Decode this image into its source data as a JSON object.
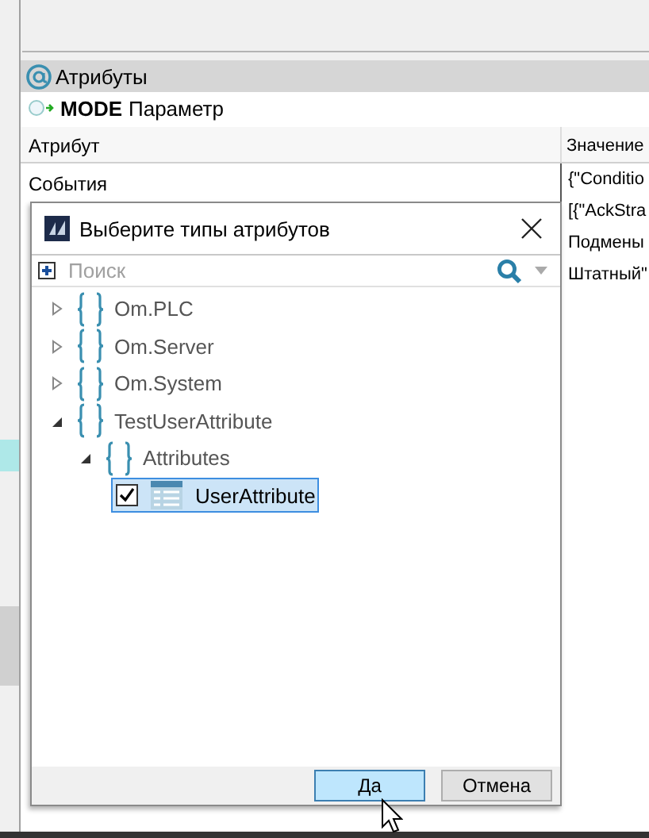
{
  "panel": {
    "title": "Атрибуты"
  },
  "object": {
    "name": "MODE",
    "type": "Параметр"
  },
  "table": {
    "columns": [
      "Атрибут",
      "Значение"
    ],
    "rows": [
      {
        "attribute": "События",
        "values": [
          "{\"Conditio",
          "[{\"AckStra",
          "Подмены",
          "Штатный\""
        ]
      }
    ]
  },
  "dialog": {
    "title": "Выберите типы атрибутов",
    "search": {
      "placeholder": "Поиск"
    },
    "tree": [
      {
        "kind": "namespace",
        "label": "Om.PLC",
        "expanded": false
      },
      {
        "kind": "namespace",
        "label": "Om.Server",
        "expanded": false
      },
      {
        "kind": "namespace",
        "label": "Om.System",
        "expanded": false
      },
      {
        "kind": "namespace",
        "label": "TestUserAttribute",
        "expanded": true,
        "children": [
          {
            "kind": "namespace",
            "label": "Attributes",
            "expanded": true,
            "children": [
              {
                "kind": "type",
                "label": "UserAttribute",
                "checked": true,
                "selected": true
              }
            ]
          }
        ]
      }
    ],
    "buttons": [
      {
        "label": "Да",
        "kind": "primary"
      },
      {
        "label": "Отмена",
        "kind": "normal"
      }
    ]
  }
}
